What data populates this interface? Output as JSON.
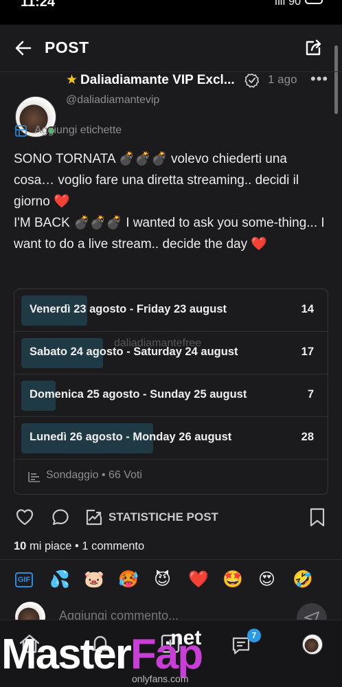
{
  "status_bar": {
    "time": "11:24",
    "signal": "ıllı 90"
  },
  "header": {
    "title": "POST"
  },
  "author": {
    "name": "Daliadiamante VIP Excl...",
    "handle": "@daliadiamantevip",
    "time_ago": "1 ago"
  },
  "tags": {
    "label": "Aggiungi etichette"
  },
  "post": {
    "line1": "SONO TORNATA 💣💣💣 volevo chiederti una cosa… voglio fare una diretta streaming.. decidi il giorno ❤️",
    "line2": "I'M BACK 💣💣💣 I wanted to ask you some-thing... I want to do a live stream.. decide the day ❤️"
  },
  "poll": {
    "options": [
      {
        "label": "Venerdì 23 agosto - Friday 23 august",
        "votes": "14",
        "share": 0.21
      },
      {
        "label": "Sabato 24 agosto - Saturday 24 august",
        "votes": "17",
        "share": 0.26
      },
      {
        "label": "Domenica 25 agosto - Sunday 25 august",
        "votes": "7",
        "share": 0.11
      },
      {
        "label": "Lunedì 26 agosto - Monday 26 august",
        "votes": "28",
        "share": 0.42
      }
    ],
    "footer_type": "Sondaggio",
    "footer_separator": "•",
    "footer_votes": "66 Voti"
  },
  "watermark": "daliadiamantefree",
  "actions": {
    "stats_label": "STATISTICHE POST"
  },
  "counts": {
    "likes_num": "10",
    "likes_label": "mi piace",
    "separator": "•",
    "comments": "1 commento"
  },
  "reactions": {
    "gif": "GIF",
    "emojis": [
      "💦",
      "🐷",
      "🥵",
      "😈",
      "❤️",
      "🤩",
      "😍",
      "🤣"
    ]
  },
  "comment": {
    "placeholder": "Aggiungi commento..."
  },
  "nav": {
    "messages_badge": "7"
  },
  "overlay": {
    "brand_master": "Master",
    "brand_fap": "Fap",
    "brand_net": ".net",
    "url": "onlyfans.com"
  },
  "colors": {
    "accent": "#2a8ee0",
    "poll_fill": "#1f3a45",
    "online": "#3ec35f",
    "brand": "#c83fd6"
  }
}
